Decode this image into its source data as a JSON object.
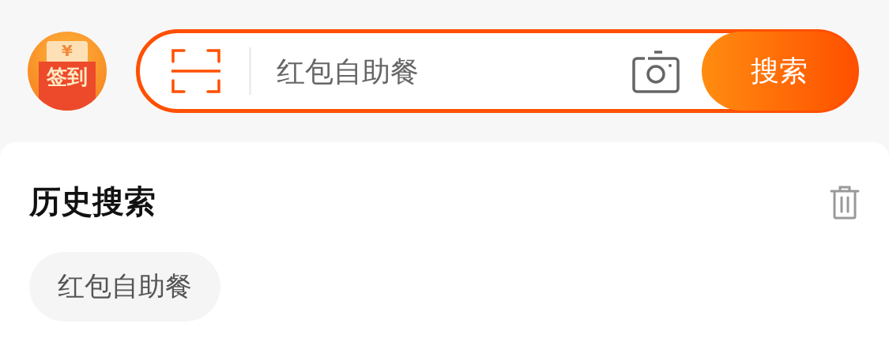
{
  "signin_badge": {
    "symbol": "¥",
    "label": "签到"
  },
  "search": {
    "placeholder": "红包自助餐",
    "button": "搜索"
  },
  "history": {
    "title": "历史搜索",
    "items": [
      "红包自助餐"
    ]
  }
}
